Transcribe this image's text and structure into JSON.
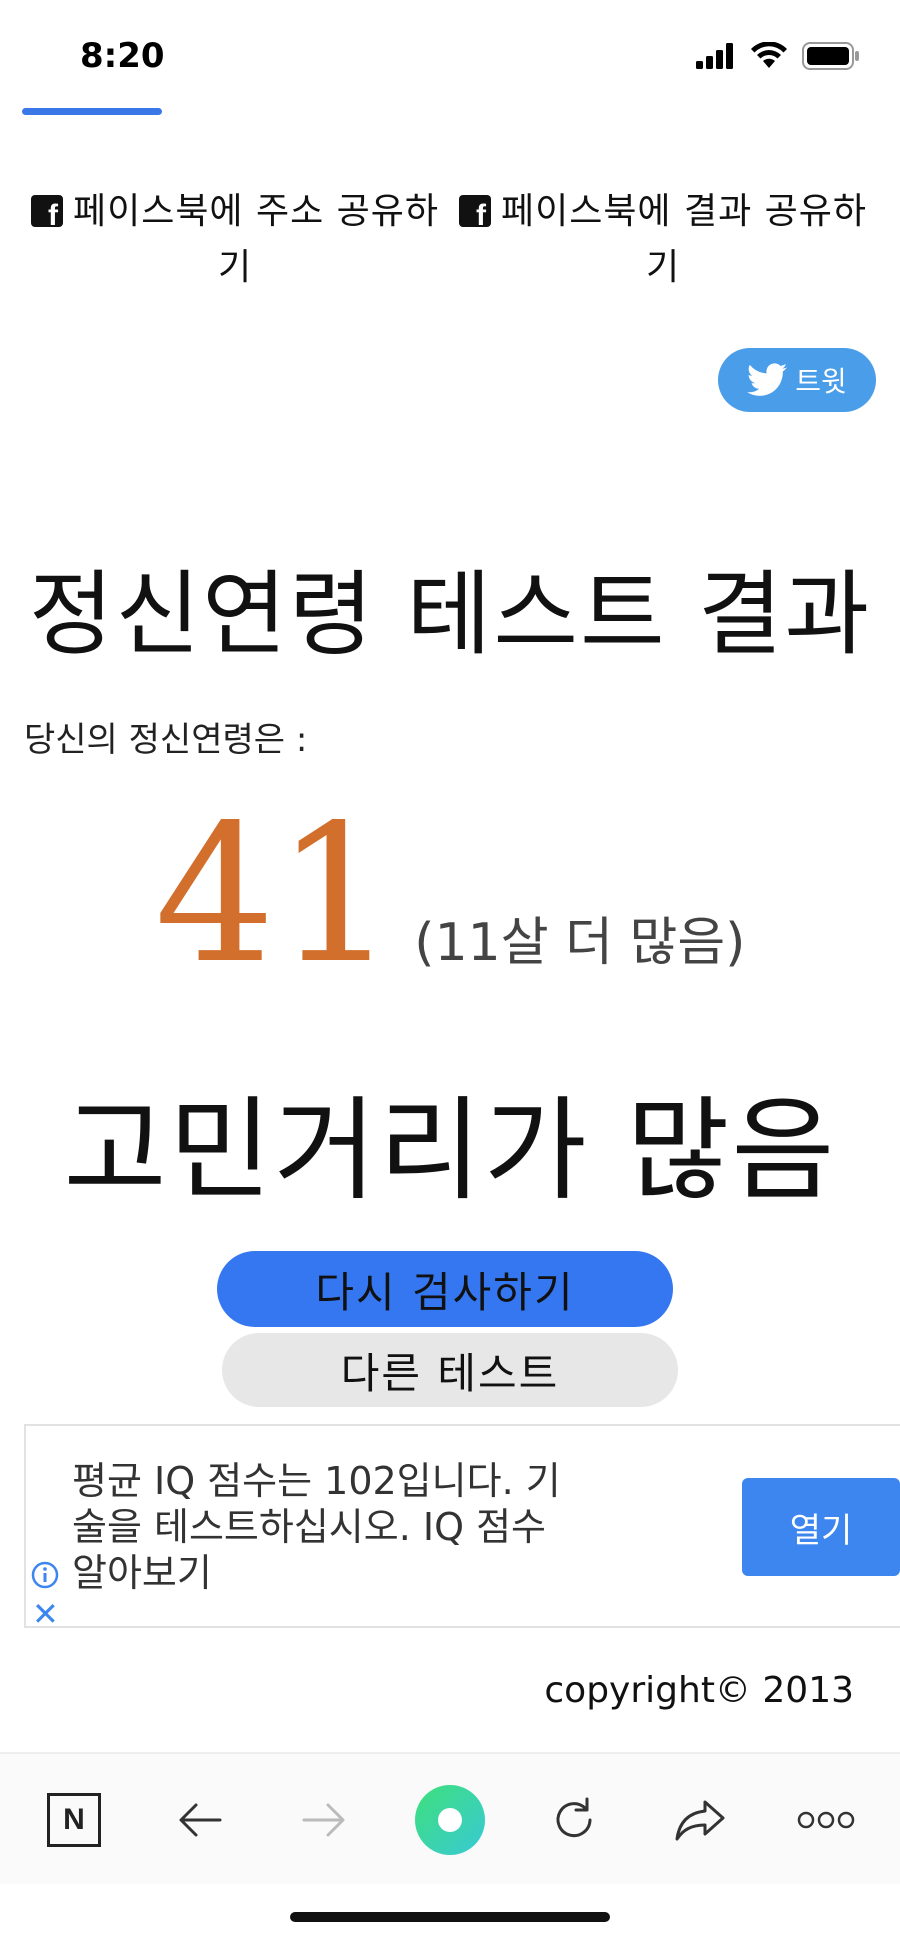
{
  "status_bar": {
    "time": "8:20"
  },
  "share": {
    "fb_address": "페이스북에 주소 공유하기",
    "fb_result": "페이스북에 결과 공유하기",
    "tweet": "트윗"
  },
  "result": {
    "title": "정신연령 테스트 결과",
    "age_label": "당신의 정신연령은 :",
    "age_value": "41",
    "age_diff": "(11살 더 많음)",
    "description": "고민거리가 많음"
  },
  "buttons": {
    "retry": "다시 검사하기",
    "other": "다른 테스트"
  },
  "ad": {
    "text": "평균 IQ 점수는 102입니다. 기술을 테스트하십시오. IQ 점수 알아보기",
    "open": "열기",
    "close": "✕"
  },
  "footer": {
    "copyright": "copyright© 2013"
  },
  "toolbar": {
    "n_label": "N"
  },
  "colors": {
    "accent_blue": "#3577f0",
    "age_orange": "#d26f2c",
    "tweet_blue": "#4a9de8"
  }
}
